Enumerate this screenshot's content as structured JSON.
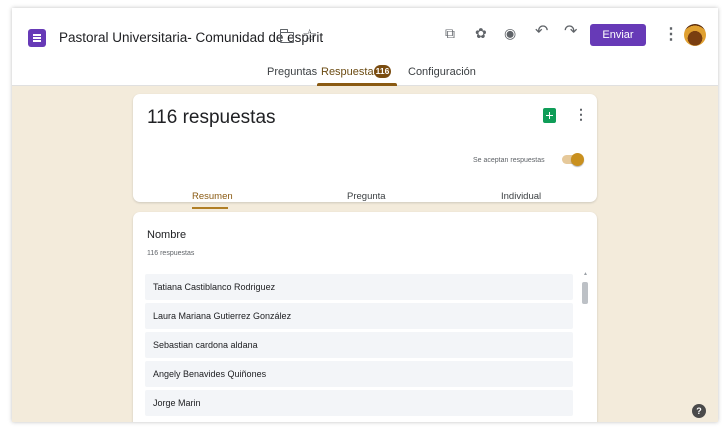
{
  "header": {
    "doc_title": "Pastoral Universitaria- Comunidad de espirit",
    "send_label": "Enviar",
    "icons": [
      "forms-app-icon",
      "folder-icon",
      "star-icon",
      "addon-icon",
      "palette-icon",
      "preview-icon",
      "undo-icon",
      "redo-icon",
      "more-vert-icon",
      "avatar"
    ]
  },
  "tabs": {
    "preguntas": "Preguntas",
    "respuestas": "Respuestas",
    "respuestas_badge": "116",
    "configuracion": "Configuración"
  },
  "summary": {
    "count_label": "116 respuestas",
    "accepting_label": "Se aceptan respuestas",
    "accepting_on": true,
    "sub_tabs": {
      "resumen": "Resumen",
      "pregunta": "Pregunta",
      "individual": "Individual"
    }
  },
  "question": {
    "title": "Nombre",
    "count": "116 respuestas",
    "answers": [
      "Tatiana Castiblanco Rodriguez",
      "Laura Mariana Gutierrez González",
      "Sebastian cardona aldana",
      "Angely Benavides Quiñones",
      "Jorge Marin"
    ]
  },
  "colors": {
    "brand": "#673ab7",
    "accent": "#8a5a12",
    "background": "#f3ebdb"
  }
}
